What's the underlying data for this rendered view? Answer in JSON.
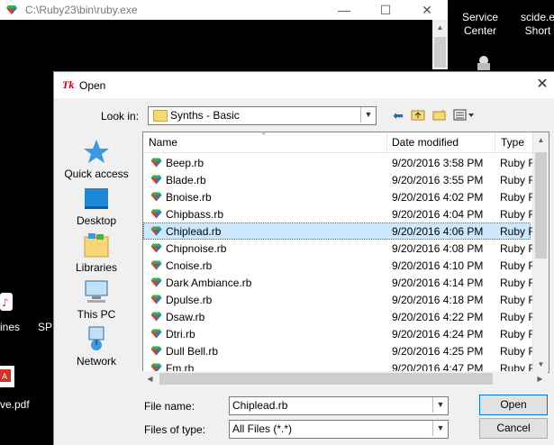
{
  "console": {
    "title": "C:\\Ruby23\\bin\\ruby.exe",
    "minimize": "—",
    "maximize": "☐",
    "close": "✕"
  },
  "desktop": {
    "icons": [
      {
        "label_line1": "Service",
        "label_line2": "Center"
      },
      {
        "label_line1": "scide.e",
        "label_line2": "Short"
      },
      {
        "label_line1": "ines"
      },
      {
        "label_line1": "SP"
      },
      {
        "label_line1": "ve.pdf"
      }
    ]
  },
  "dialog": {
    "title": "Open",
    "close": "✕",
    "look_in_label": "Look in:",
    "look_in_value": "Synths - Basic",
    "places": [
      {
        "label": "Quick access"
      },
      {
        "label": "Desktop"
      },
      {
        "label": "Libraries"
      },
      {
        "label": "This PC"
      },
      {
        "label": "Network"
      }
    ],
    "columns": {
      "name": "Name",
      "date": "Date modified",
      "type": "Type"
    },
    "files": [
      {
        "name": "Beep.rb",
        "date": "9/20/2016 3:58 PM",
        "type": "Ruby F"
      },
      {
        "name": "Blade.rb",
        "date": "9/20/2016 3:55 PM",
        "type": "Ruby F"
      },
      {
        "name": "Bnoise.rb",
        "date": "9/20/2016 4:02 PM",
        "type": "Ruby F"
      },
      {
        "name": "Chipbass.rb",
        "date": "9/20/2016 4:04 PM",
        "type": "Ruby F"
      },
      {
        "name": "Chiplead.rb",
        "date": "9/20/2016 4:06 PM",
        "type": "Ruby F",
        "selected": true
      },
      {
        "name": "Chipnoise.rb",
        "date": "9/20/2016 4:08 PM",
        "type": "Ruby F"
      },
      {
        "name": "Cnoise.rb",
        "date": "9/20/2016 4:10 PM",
        "type": "Ruby F"
      },
      {
        "name": "Dark Ambiance.rb",
        "date": "9/20/2016 4:14 PM",
        "type": "Ruby F"
      },
      {
        "name": "Dpulse.rb",
        "date": "9/20/2016 4:18 PM",
        "type": "Ruby F"
      },
      {
        "name": "Dsaw.rb",
        "date": "9/20/2016 4:22 PM",
        "type": "Ruby F"
      },
      {
        "name": "Dtri.rb",
        "date": "9/20/2016 4:24 PM",
        "type": "Ruby F"
      },
      {
        "name": "Dull Bell.rb",
        "date": "9/20/2016 4:25 PM",
        "type": "Ruby F"
      },
      {
        "name": "Fm.rb",
        "date": "9/20/2016 4:47 PM",
        "type": "Ruby F"
      }
    ],
    "file_name_label": "File name:",
    "file_name_value": "Chiplead.rb",
    "file_type_label": "Files of type:",
    "file_type_value": "All Files (*.*)",
    "open_label": "Open",
    "cancel_label": "Cancel"
  },
  "colors": {
    "selection": "#cce8ff",
    "accent": "#0078d7"
  }
}
